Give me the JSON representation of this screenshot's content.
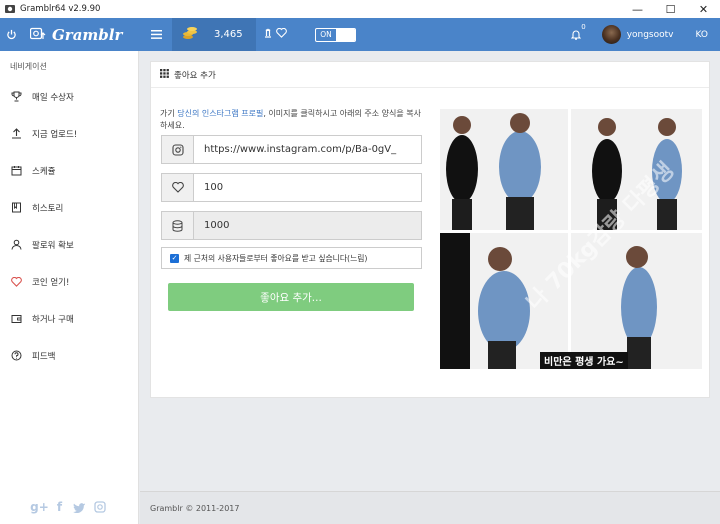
{
  "window": {
    "title": "Gramblr64 v2.9.90",
    "minimize": "—",
    "maximize": "☐",
    "close": "✕"
  },
  "topnav": {
    "logo": "Gramblr",
    "coins": "3,465",
    "toggle": "ON",
    "notifications": "0",
    "username": "yongsootv",
    "language": "KO"
  },
  "sidebar": {
    "heading": "네비게이션",
    "items": [
      {
        "label": "매일 수상자",
        "icon": "trophy-icon"
      },
      {
        "label": "지금 업로드!",
        "icon": "upload-icon"
      },
      {
        "label": "스케쥴",
        "icon": "calendar-icon"
      },
      {
        "label": "히스토리",
        "icon": "book-icon"
      },
      {
        "label": "팔로워 확보",
        "icon": "user-icon"
      },
      {
        "label": "코인 얻기!",
        "icon": "heart-icon"
      },
      {
        "label": "하거나 구매",
        "icon": "wallet-icon"
      },
      {
        "label": "피드백",
        "icon": "question-icon"
      }
    ],
    "social": [
      "google-plus-icon",
      "facebook-icon",
      "twitter-icon",
      "instagram-icon"
    ]
  },
  "panel": {
    "title": "좋아요 추가",
    "instruction_prefix": "가기 ",
    "instruction_link": "당신의 인스타그램 프로필",
    "instruction_suffix": ", 이미지를 클릭하시고 아래의 주소 양식을 복사하세요.",
    "url_value": "https://www.instagram.com/p/Ba-0gV_",
    "likes_value": "100",
    "coins_value": "1000",
    "checkbox_label": "제 근처의 사용자들로부터 좋아요를 받고 싶습니다(느림)",
    "submit_label": "좋아요 추가...",
    "photo_overlay": "나 70kg감량 다평생",
    "photo_caption": "비만은 평생 가요~"
  },
  "footer": {
    "text": "Gramblr © 2011-2017"
  },
  "colors": {
    "accent": "#4a84c9",
    "submit": "#7fcc7f",
    "heart": "#d9534f"
  }
}
